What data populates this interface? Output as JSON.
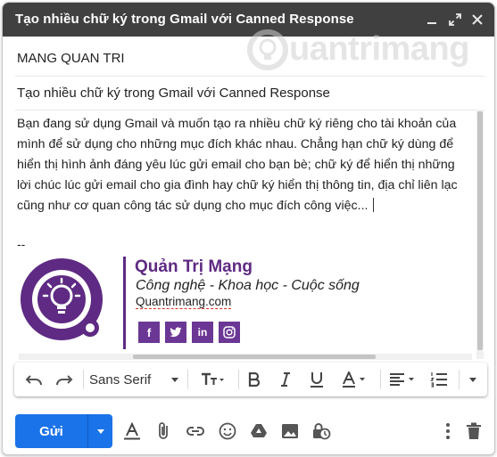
{
  "window": {
    "title": "Tạo nhiều chữ ký trong Gmail với Canned Response"
  },
  "watermark": {
    "text": "uantrimang"
  },
  "compose": {
    "to": "MANG QUAN TRI",
    "subject": "Tạo nhiều chữ ký trong Gmail với Canned Response",
    "body_lines": [
      "Bạn đang sử dụng Gmail và muốn tạo ra nhiều chữ ký riêng cho tài khoản của",
      "mình để sử dụng cho những mục đích khác nhau. Chẳng hạn chữ ký dùng để",
      "hiển thị hình ảnh đáng yêu lúc gửi email cho bạn bè; chữ ký để hiển thị những",
      "lời chúc lúc gửi email cho gia đình hay chữ ký hiển thị thông tin, địa chỉ liên lạc",
      "cũng như cơ quan công tác sử dụng cho mục đích công việc..."
    ],
    "signature_separator": "--"
  },
  "signature": {
    "name": "Quản Trị Mạng",
    "tagline": "Công nghệ - Khoa học - Cuộc sống",
    "website": "Quantrimang.com",
    "socials": [
      {
        "icon": "facebook-icon",
        "glyph": "f"
      },
      {
        "icon": "twitter-icon",
        "glyph": "t"
      },
      {
        "icon": "linkedin-icon",
        "glyph": "in"
      },
      {
        "icon": "instagram-icon",
        "glyph": "ig"
      }
    ]
  },
  "format_toolbar": {
    "font": "Sans Serif"
  },
  "bottom_bar": {
    "send_label": "Gửi"
  },
  "colors": {
    "titlebar": "#404040",
    "send_button": "#1a73e8",
    "brand_purple": "#5e2a83"
  }
}
